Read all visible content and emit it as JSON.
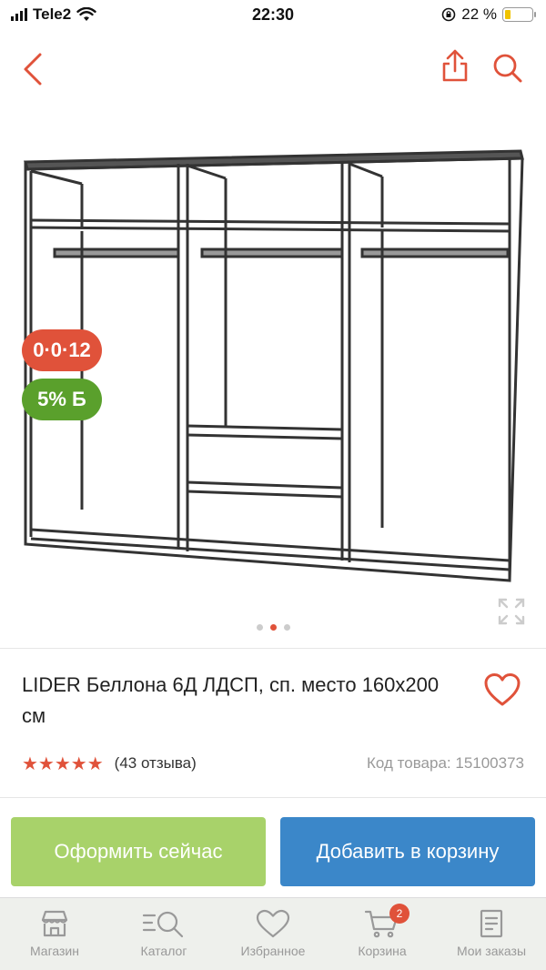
{
  "status_bar": {
    "carrier": "Tele2",
    "time": "22:30",
    "battery_percent": "22 %",
    "battery_level": 0.22
  },
  "nav": {
    "back_icon": "chevron-left-icon",
    "share_icon": "share-icon",
    "search_icon": "search-icon"
  },
  "gallery": {
    "image_subject": "wardrobe-drawing",
    "badges": {
      "installment": "0·0·12",
      "bonus": "5% Б"
    },
    "page_count": 3,
    "active_page": 2
  },
  "product": {
    "title": "LIDER Беллона 6Д ЛДСП, сп. место 160х200 см",
    "rating_stars": "★★★★★",
    "rating_value": 5,
    "reviews": "(43 отзыва)",
    "sku": "Код товара: 15100373"
  },
  "actions": {
    "buy_now": "Оформить сейчас",
    "add_to_cart": "Добавить в корзину"
  },
  "tabbar": {
    "items": [
      {
        "label": "Магазин",
        "icon": "store-icon"
      },
      {
        "label": "Каталог",
        "icon": "catalog-search-icon"
      },
      {
        "label": "Избранное",
        "icon": "heart-icon"
      },
      {
        "label": "Корзина",
        "icon": "cart-icon",
        "badge": "2"
      },
      {
        "label": "Мои заказы",
        "icon": "orders-icon"
      }
    ]
  },
  "colors": {
    "accent_red": "#e0523a",
    "bonus_green": "#5aa02c",
    "buy_green": "#a8d26a",
    "cart_blue": "#3b87c9"
  }
}
